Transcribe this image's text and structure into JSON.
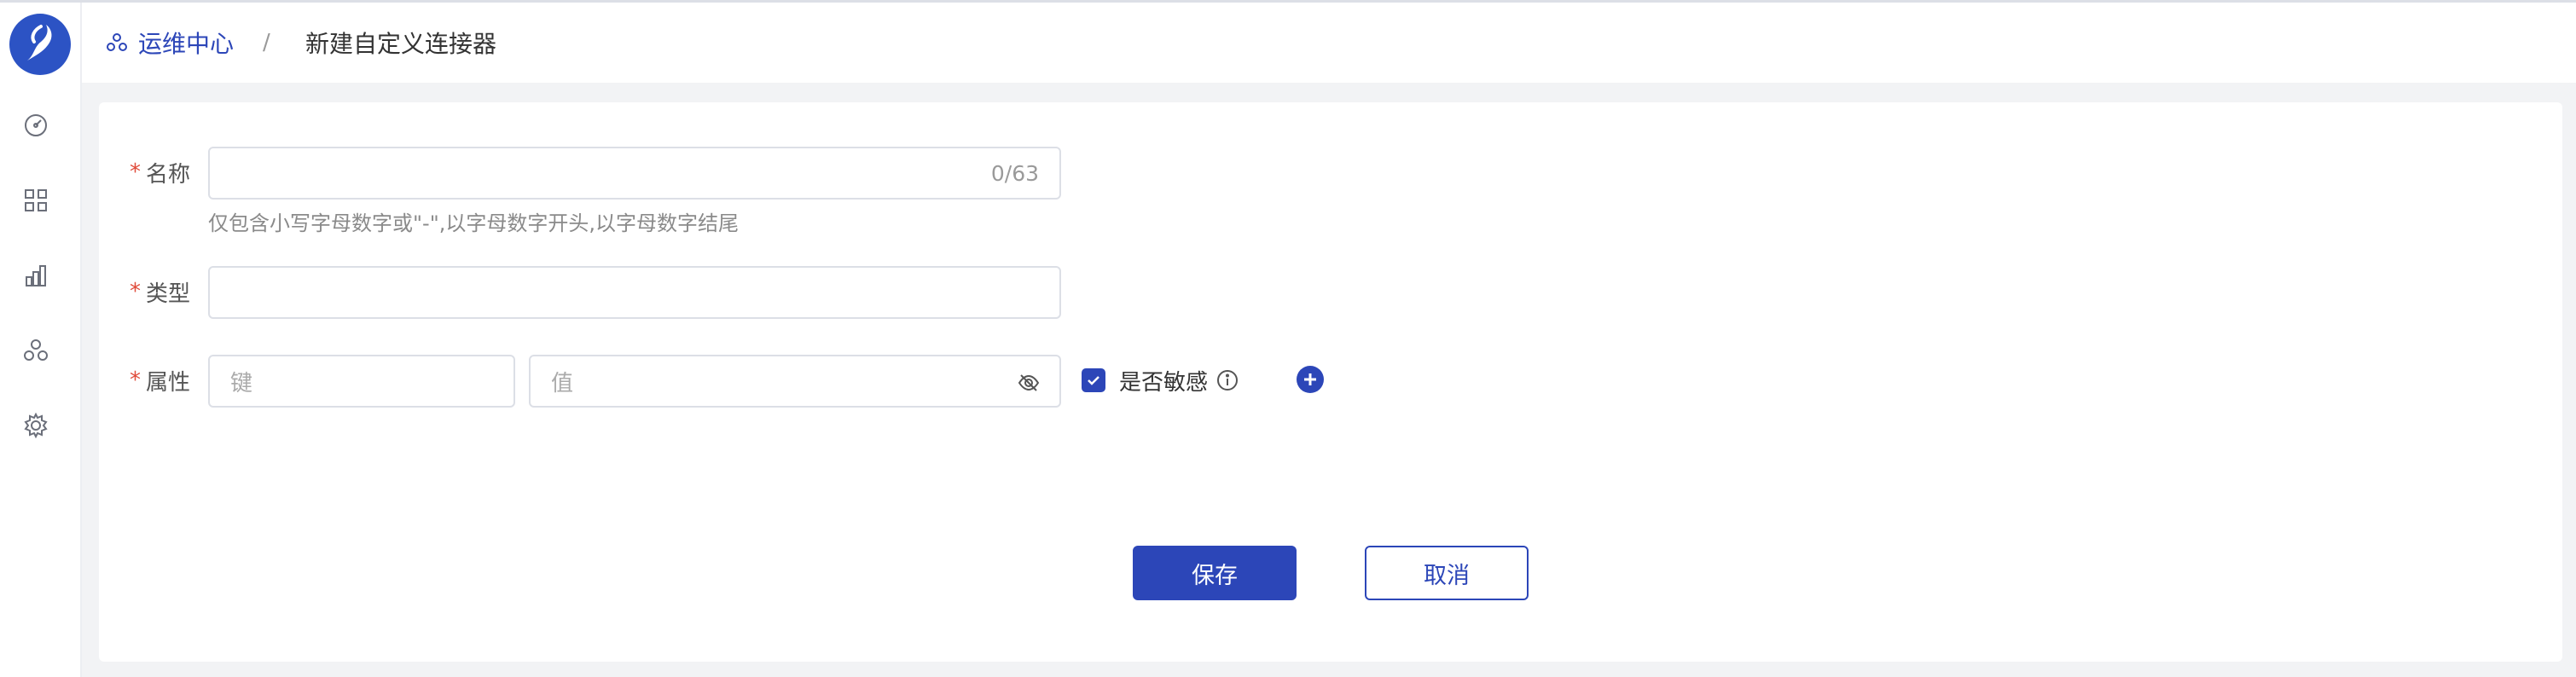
{
  "breadcrumb": {
    "home": "运维中心",
    "separator": "/",
    "current": "新建自定义连接器"
  },
  "sidebar": {
    "items": [
      {
        "icon": "dashboard-icon"
      },
      {
        "icon": "grid-icon"
      },
      {
        "icon": "bar-chart-icon"
      },
      {
        "icon": "cluster-icon"
      },
      {
        "icon": "gear-icon"
      }
    ]
  },
  "form": {
    "name": {
      "required": "*",
      "label": "名称",
      "value": "",
      "counter": "0/63",
      "hint": "仅包含小写字母数字或\"-\",以字母数字开头,以字母数字结尾"
    },
    "type": {
      "required": "*",
      "label": "类型",
      "value": ""
    },
    "props": {
      "required": "*",
      "label": "属性",
      "key_placeholder": "键",
      "value_placeholder": "值",
      "sensitive_label": "是否敏感",
      "sensitive_checked": true
    }
  },
  "actions": {
    "save": "保存",
    "cancel": "取消"
  },
  "colors": {
    "accent": "#2c46b8",
    "required": "#e04b3a"
  }
}
